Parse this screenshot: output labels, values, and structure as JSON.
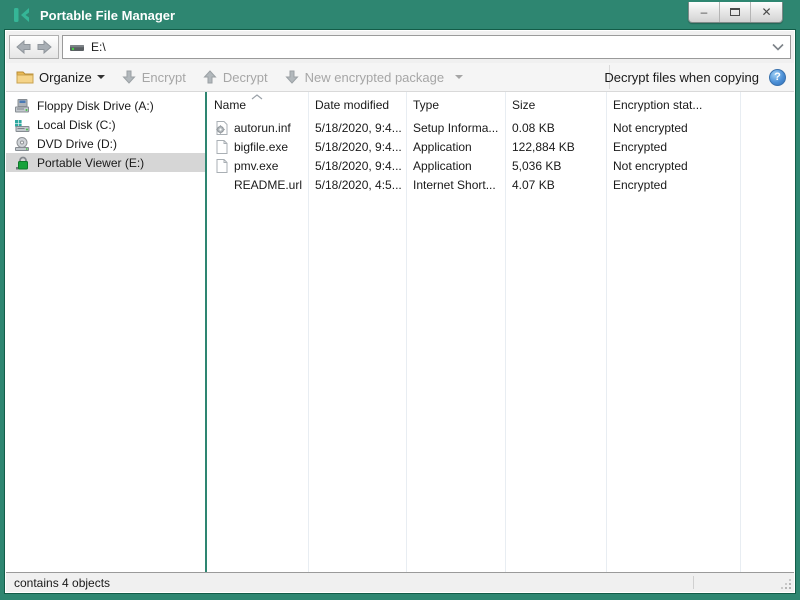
{
  "window": {
    "title": "Portable File Manager",
    "controls": {
      "minimize": "–",
      "maximize": "",
      "close": "✕"
    }
  },
  "colors": {
    "titlebar": "#2e8671",
    "logo_green": "#35b697",
    "selection": "#d6d6d6",
    "help_blue": "#4b8fd6",
    "lock_green": "#17a23b",
    "disabled_text": "#a6a6a6"
  },
  "navbar": {
    "address": "E:\\"
  },
  "toolbar": {
    "items": [
      {
        "label": "Organize",
        "icon": "folder-icon",
        "enabled": true,
        "has_dropdown": true
      },
      {
        "label": "Encrypt",
        "icon": "arrow-down-icon",
        "enabled": false,
        "has_dropdown": false
      },
      {
        "label": "Decrypt",
        "icon": "arrow-up-icon",
        "enabled": false,
        "has_dropdown": false
      },
      {
        "label": "New encrypted package",
        "icon": "arrow-down-icon",
        "enabled": false,
        "has_dropdown": true
      }
    ],
    "right_label": "Decrypt files when copying",
    "help_glyph": "?"
  },
  "sidebar": {
    "items": [
      {
        "label": "Floppy Disk Drive (A:)",
        "icon": "floppy-drive-icon",
        "selected": false
      },
      {
        "label": "Local Disk (C:)",
        "icon": "hard-disk-icon",
        "selected": false
      },
      {
        "label": "DVD Drive (D:)",
        "icon": "dvd-drive-icon",
        "selected": false
      },
      {
        "label": "Portable Viewer (E:)",
        "icon": "lock-icon",
        "selected": true
      }
    ]
  },
  "filelist": {
    "columns": [
      "Name",
      "Date modified",
      "Type",
      "Size",
      "Encryption stat..."
    ],
    "sort_column": "Name",
    "sort_direction": "ascending",
    "rows": [
      {
        "icon": "setup-file-icon",
        "name": "autorun.inf",
        "date": "5/18/2020, 9:4...",
        "type": "Setup Informa...",
        "size": "0.08 KB",
        "status": "Not encrypted"
      },
      {
        "icon": "file-icon",
        "name": "bigfile.exe",
        "date": "5/18/2020, 9:4...",
        "type": "Application",
        "size": "122,884 KB",
        "status": "Encrypted"
      },
      {
        "icon": "file-icon",
        "name": "pmv.exe",
        "date": "5/18/2020, 9:4...",
        "type": "Application",
        "size": "5,036 KB",
        "status": "Not encrypted"
      },
      {
        "icon": "none",
        "name": "README.url",
        "date": "5/18/2020, 4:5...",
        "type": "Internet Short...",
        "size": "4.07 KB",
        "status": "Encrypted"
      }
    ]
  },
  "statusbar": {
    "text": "contains 4 objects"
  }
}
